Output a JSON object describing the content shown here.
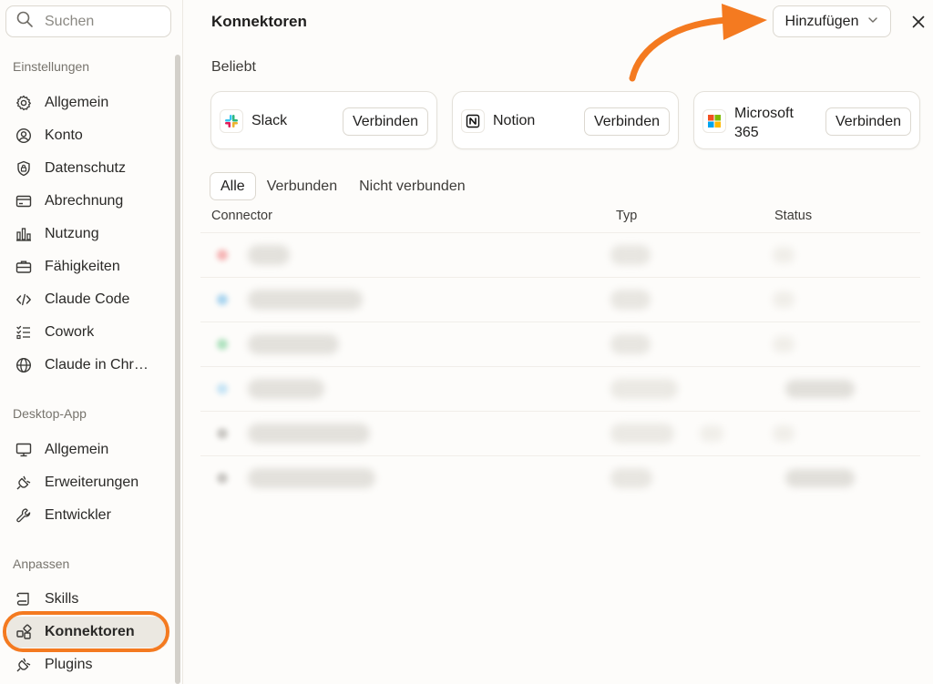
{
  "sidebar": {
    "search_placeholder": "Suchen",
    "sections": [
      {
        "title": "Einstellungen",
        "items": [
          {
            "label": "Allgemein",
            "icon": "gear-icon"
          },
          {
            "label": "Konto",
            "icon": "user-circle-icon"
          },
          {
            "label": "Datenschutz",
            "icon": "shield-lock-icon"
          },
          {
            "label": "Abrechnung",
            "icon": "credit-card-icon"
          },
          {
            "label": "Nutzung",
            "icon": "bar-chart-icon"
          },
          {
            "label": "Fähigkeiten",
            "icon": "toolbox-icon"
          },
          {
            "label": "Claude Code",
            "icon": "code-icon"
          },
          {
            "label": "Cowork",
            "icon": "checklist-icon"
          },
          {
            "label": "Claude in Chr…",
            "icon": "globe-icon"
          }
        ]
      },
      {
        "title": "Desktop-App",
        "items": [
          {
            "label": "Allgemein",
            "icon": "monitor-icon"
          },
          {
            "label": "Erweiterungen",
            "icon": "plug-icon"
          },
          {
            "label": "Entwickler",
            "icon": "wrench-icon"
          }
        ]
      },
      {
        "title": "Anpassen",
        "items": [
          {
            "label": "Skills",
            "icon": "scroll-icon"
          },
          {
            "label": "Konnektoren",
            "icon": "connectors-icon",
            "active": true
          },
          {
            "label": "Plugins",
            "icon": "plug-icon"
          }
        ]
      }
    ]
  },
  "main": {
    "title": "Konnektoren",
    "add_button": "Hinzufügen",
    "popular_label": "Beliebt",
    "popular": [
      {
        "name": "Slack",
        "connect": "Verbinden",
        "icon": "slack-icon"
      },
      {
        "name": "Notion",
        "connect": "Verbinden",
        "icon": "notion-icon"
      },
      {
        "name": "Microsoft 365",
        "connect": "Verbinden",
        "icon": "microsoft-icon"
      }
    ],
    "filters": [
      "Alle",
      "Verbunden",
      "Nicht verbunden"
    ],
    "active_filter": "Alle",
    "columns": [
      "Connector",
      "Typ",
      "Status"
    ]
  },
  "colors": {
    "accent_orange": "#f47a20",
    "active_bg": "#ebe8e1"
  }
}
